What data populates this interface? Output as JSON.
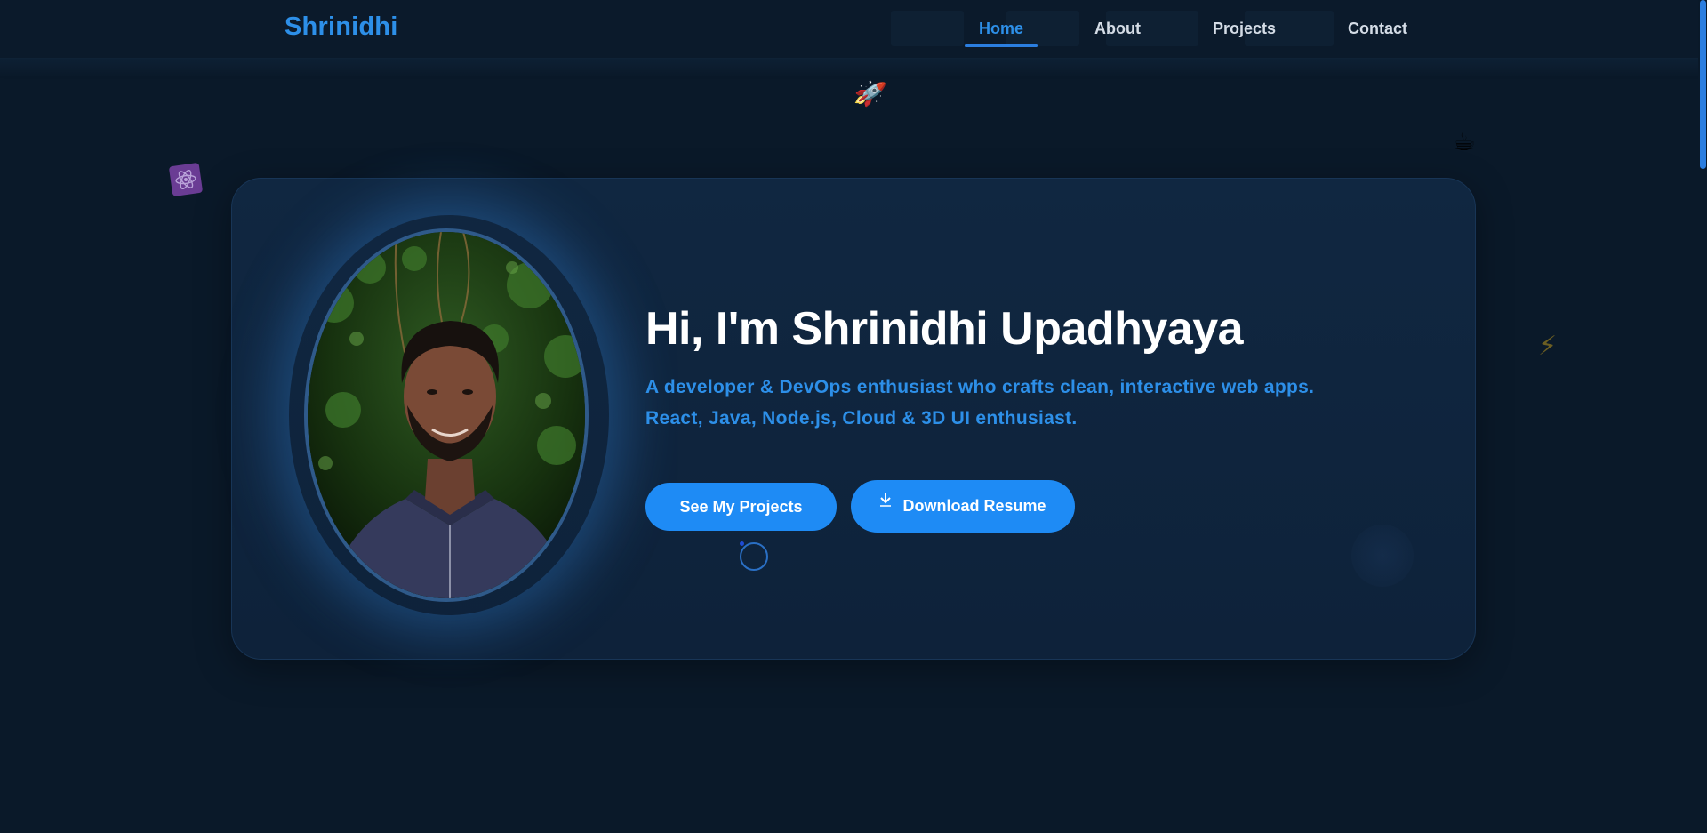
{
  "navbar": {
    "brand": "Shrinidhi",
    "links": [
      {
        "label": "Home",
        "active": true
      },
      {
        "label": "About",
        "active": false
      },
      {
        "label": "Projects",
        "active": false
      },
      {
        "label": "Contact",
        "active": false
      }
    ]
  },
  "floating_icons": [
    {
      "name": "rocket-icon",
      "glyph": "🚀"
    },
    {
      "name": "coffee-icon",
      "glyph": "☕"
    },
    {
      "name": "react-icon",
      "glyph": "⚛"
    },
    {
      "name": "lightning-icon",
      "glyph": "⚡"
    }
  ],
  "hero": {
    "title": "Hi, I'm Shrinidhi Upadhyaya",
    "subtitle_line1": "A developer & DevOps enthusiast who crafts clean, interactive web apps.",
    "subtitle_line2": "React, Java, Node.js, Cloud & 3D UI enthusiast.",
    "buttons": {
      "projects_label": "See My Projects",
      "resume_label": "Download Resume"
    },
    "portrait_alt": "Profile photo"
  },
  "colors": {
    "background": "#0a1929",
    "accent": "#2d8fe8",
    "button": "#1e8bf5",
    "card": "#102741"
  }
}
